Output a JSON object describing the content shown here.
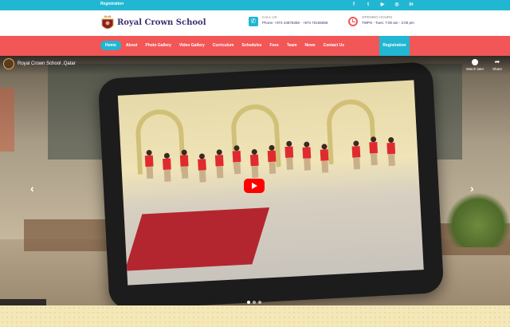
{
  "topbar": {
    "registration_link": "Registration",
    "social_icons": [
      "facebook-icon",
      "twitter-icon",
      "youtube-icon",
      "instagram-icon",
      "linkedin-icon"
    ],
    "social_glyphs": [
      "f",
      "t",
      "▶",
      "◎",
      "in"
    ]
  },
  "header": {
    "brand": "Royal Crown School",
    "call_label": "CALL US",
    "phones": "Phone: +974 44876359  ·  +974 70165065",
    "hours_label": "OPENING HOURS",
    "hours_value": "TWPS - Tues: 7:00 am - 2:00 pm"
  },
  "nav": {
    "items": [
      "Home",
      "About",
      "Photo Gallery",
      "Video Gallery",
      "Curriculum",
      "Schedules",
      "Fees",
      "Team",
      "News",
      "Contact Us"
    ],
    "active": "Home",
    "registration_button": "Registration"
  },
  "video": {
    "title": "Royal Crown School ,Qatar",
    "watch_later": "Watch later",
    "share": "Share",
    "slides": 3,
    "active_slide": 1
  },
  "colors": {
    "accent_cyan": "#21b6d2",
    "accent_coral": "#f25656",
    "brand_purple": "#3c2e6e"
  }
}
